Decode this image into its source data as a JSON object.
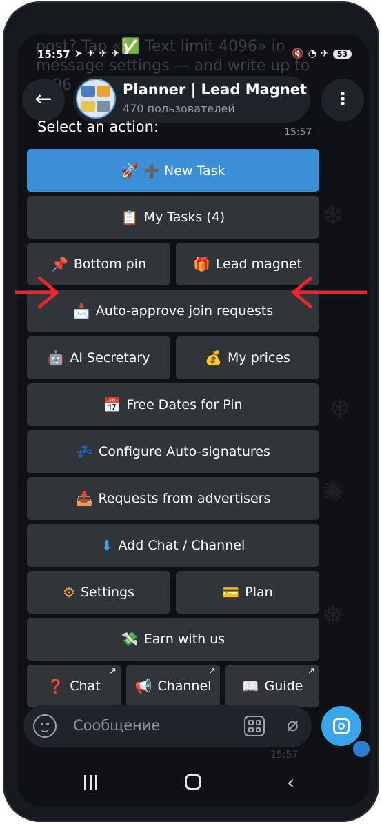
{
  "status_bar": {
    "time": "15:57",
    "battery": "53",
    "left_icons": [
      "navigation-icon",
      "telegram-icon",
      "telegram-icon",
      "telegram-icon",
      "dot-icon"
    ],
    "right_icons": [
      "mute-icon",
      "wifi-icon",
      "airplane-icon",
      "battery-icon"
    ]
  },
  "background": {
    "text_line1": "post? Tap «✅ Text limit 4096» in",
    "text_line2": "message settings — and write up to",
    "text_line3": "96"
  },
  "header": {
    "title": "Planner | Lead Magnet",
    "subtitle": "470 пользователей",
    "back_icon": "arrow-left-icon",
    "menu_icon": "more-vertical-icon"
  },
  "message": {
    "text": "Select an action:",
    "time": "15:57"
  },
  "keyboard": {
    "new_task": "➕ New Task",
    "new_task_emoji": "🚀",
    "my_tasks": "My Tasks (4)",
    "my_tasks_emoji": "📋",
    "bottom_pin": "Bottom pin",
    "bottom_pin_emoji": "📌",
    "lead_magnet": "Lead magnet",
    "lead_magnet_emoji": "🎁",
    "auto_approve": "Auto-approve join requests",
    "auto_approve_emoji": "📩",
    "ai_secretary": "AI Secretary",
    "ai_secretary_emoji": "🤖",
    "my_prices": "My prices",
    "my_prices_emoji": "💰",
    "free_dates": "Free Dates for Pin",
    "free_dates_emoji": "📅",
    "auto_signatures": "Configure Auto-signatures",
    "auto_signatures_emoji": "💤",
    "requests_advertisers": "Requests from advertisers",
    "requests_advertisers_emoji": "📥",
    "add_chat": "Add Chat / Channel",
    "add_chat_emoji": "⬇",
    "settings": "Settings",
    "settings_emoji": "⚙",
    "plan": "Plan",
    "plan_emoji": "💳",
    "earn": "Earn with us",
    "earn_emoji": "💸",
    "chat": "Chat",
    "chat_emoji": "❓",
    "channel": "Channel",
    "channel_emoji": "📢",
    "guide": "Guide",
    "guide_emoji": "📖",
    "link_corner": "↗"
  },
  "annotations": {
    "arrow_color": "#e8262e"
  },
  "input": {
    "placeholder": "Сообщение"
  },
  "faded": {
    "time": "15:57"
  },
  "colors": {
    "primary_button": "#3b8fd6",
    "button_bg": "#34383e",
    "camera_button": "#3aa6e8"
  }
}
